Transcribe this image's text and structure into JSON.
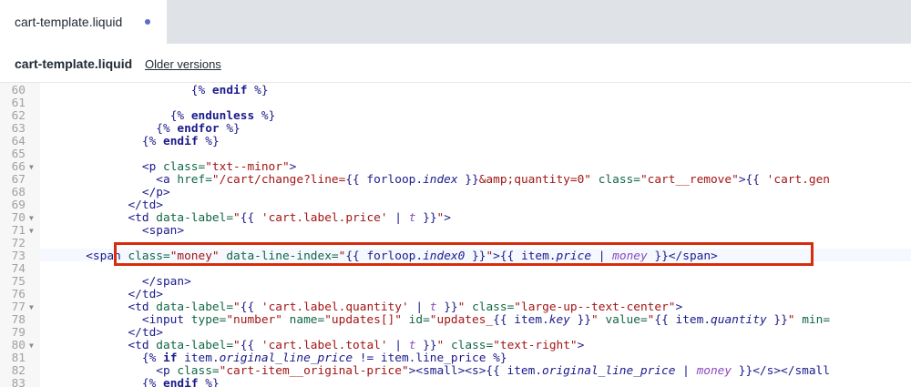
{
  "tab": {
    "label": "cart-template.liquid"
  },
  "header": {
    "title": "cart-template.liquid",
    "older_versions": "Older versions"
  },
  "editor": {
    "highlighted_line": 73,
    "lines": [
      {
        "n": "60",
        "fold": false,
        "indent": "",
        "code": [
          {
            "t": "                     "
          },
          {
            "t": "{% ",
            "c": "t-var"
          },
          {
            "t": "endif",
            "c": "t-kw"
          },
          {
            "t": " %}",
            "c": "t-var"
          }
        ]
      },
      {
        "n": "61",
        "fold": false,
        "code": []
      },
      {
        "n": "62",
        "fold": false,
        "code": [
          {
            "t": "                  "
          },
          {
            "t": "{% ",
            "c": "t-var"
          },
          {
            "t": "endunless",
            "c": "t-kw"
          },
          {
            "t": " %}",
            "c": "t-var"
          }
        ]
      },
      {
        "n": "63",
        "fold": false,
        "code": [
          {
            "t": "                "
          },
          {
            "t": "{% ",
            "c": "t-var"
          },
          {
            "t": "endfor",
            "c": "t-kw"
          },
          {
            "t": " %}",
            "c": "t-var"
          }
        ]
      },
      {
        "n": "64",
        "fold": false,
        "code": [
          {
            "t": "              "
          },
          {
            "t": "{% ",
            "c": "t-var"
          },
          {
            "t": "endif",
            "c": "t-kw"
          },
          {
            "t": " %}",
            "c": "t-var"
          }
        ]
      },
      {
        "n": "65",
        "fold": false,
        "code": []
      },
      {
        "n": "66",
        "fold": true,
        "code": [
          {
            "t": "              <p ",
            "c": "t-tag"
          },
          {
            "t": "class=",
            "c": "t-attr"
          },
          {
            "t": "\"txt--minor\"",
            "c": "t-str"
          },
          {
            "t": ">",
            "c": "t-tag"
          }
        ]
      },
      {
        "n": "67",
        "fold": false,
        "code": [
          {
            "t": "                <a ",
            "c": "t-tag"
          },
          {
            "t": "href=",
            "c": "t-attr"
          },
          {
            "t": "\"/cart/change?line=",
            "c": "t-str"
          },
          {
            "t": "{{ forloop.",
            "c": "t-var"
          },
          {
            "t": "index",
            "c": "t-prop"
          },
          {
            "t": " }}",
            "c": "t-var"
          },
          {
            "t": "&amp;quantity=0\"",
            "c": "t-str"
          },
          {
            "t": " class=",
            "c": "t-attr"
          },
          {
            "t": "\"cart__remove\"",
            "c": "t-str"
          },
          {
            "t": ">",
            "c": "t-tag"
          },
          {
            "t": "{{ ",
            "c": "t-var"
          },
          {
            "t": "'cart.gen",
            "c": "t-str"
          }
        ]
      },
      {
        "n": "68",
        "fold": false,
        "code": [
          {
            "t": "              </p>",
            "c": "t-tag"
          }
        ]
      },
      {
        "n": "69",
        "fold": false,
        "code": [
          {
            "t": "            </td>",
            "c": "t-tag"
          }
        ]
      },
      {
        "n": "70",
        "fold": true,
        "code": [
          {
            "t": "            <td ",
            "c": "t-tag"
          },
          {
            "t": "data-label=",
            "c": "t-attr"
          },
          {
            "t": "\"",
            "c": "t-str"
          },
          {
            "t": "{{ ",
            "c": "t-var"
          },
          {
            "t": "'cart.label.price'",
            "c": "t-str"
          },
          {
            "t": " | ",
            "c": "t-var"
          },
          {
            "t": "t",
            "c": "t-filter"
          },
          {
            "t": " }}",
            "c": "t-var"
          },
          {
            "t": "\"",
            "c": "t-str"
          },
          {
            "t": ">",
            "c": "t-tag"
          }
        ]
      },
      {
        "n": "71",
        "fold": true,
        "code": [
          {
            "t": "              <span>",
            "c": "t-tag"
          }
        ]
      },
      {
        "n": "72",
        "fold": false,
        "code": []
      },
      {
        "n": "73",
        "fold": false,
        "code": [
          {
            "t": "      <span ",
            "c": "t-tag"
          },
          {
            "t": "class=",
            "c": "t-attr"
          },
          {
            "t": "\"money\"",
            "c": "t-str"
          },
          {
            "t": " data-line-index=",
            "c": "t-attr"
          },
          {
            "t": "\"",
            "c": "t-str"
          },
          {
            "t": "{{ forloop.",
            "c": "t-var"
          },
          {
            "t": "index0",
            "c": "t-prop"
          },
          {
            "t": " }}",
            "c": "t-var"
          },
          {
            "t": "\"",
            "c": "t-str"
          },
          {
            "t": ">",
            "c": "t-tag"
          },
          {
            "t": "{{ item.",
            "c": "t-var"
          },
          {
            "t": "price",
            "c": "t-prop"
          },
          {
            "t": " | ",
            "c": "t-var"
          },
          {
            "t": "money",
            "c": "t-filter"
          },
          {
            "t": " }}",
            "c": "t-var"
          },
          {
            "t": "</span>",
            "c": "t-tag"
          }
        ]
      },
      {
        "n": "74",
        "fold": false,
        "code": []
      },
      {
        "n": "75",
        "fold": false,
        "code": [
          {
            "t": "              </span>",
            "c": "t-tag"
          }
        ]
      },
      {
        "n": "76",
        "fold": false,
        "code": [
          {
            "t": "            </td>",
            "c": "t-tag"
          }
        ]
      },
      {
        "n": "77",
        "fold": true,
        "code": [
          {
            "t": "            <td ",
            "c": "t-tag"
          },
          {
            "t": "data-label=",
            "c": "t-attr"
          },
          {
            "t": "\"",
            "c": "t-str"
          },
          {
            "t": "{{ ",
            "c": "t-var"
          },
          {
            "t": "'cart.label.quantity'",
            "c": "t-str"
          },
          {
            "t": " | ",
            "c": "t-var"
          },
          {
            "t": "t",
            "c": "t-filter"
          },
          {
            "t": " }}",
            "c": "t-var"
          },
          {
            "t": "\"",
            "c": "t-str"
          },
          {
            "t": " class=",
            "c": "t-attr"
          },
          {
            "t": "\"large-up--text-center\"",
            "c": "t-str"
          },
          {
            "t": ">",
            "c": "t-tag"
          }
        ]
      },
      {
        "n": "78",
        "fold": false,
        "code": [
          {
            "t": "              <input ",
            "c": "t-tag"
          },
          {
            "t": "type=",
            "c": "t-attr"
          },
          {
            "t": "\"number\"",
            "c": "t-str"
          },
          {
            "t": " name=",
            "c": "t-attr"
          },
          {
            "t": "\"updates[]\"",
            "c": "t-str"
          },
          {
            "t": " id=",
            "c": "t-attr"
          },
          {
            "t": "\"updates_",
            "c": "t-str"
          },
          {
            "t": "{{ item.",
            "c": "t-var"
          },
          {
            "t": "key",
            "c": "t-prop"
          },
          {
            "t": " }}",
            "c": "t-var"
          },
          {
            "t": "\"",
            "c": "t-str"
          },
          {
            "t": " value=",
            "c": "t-attr"
          },
          {
            "t": "\"",
            "c": "t-str"
          },
          {
            "t": "{{ item.",
            "c": "t-var"
          },
          {
            "t": "quantity",
            "c": "t-prop"
          },
          {
            "t": " }}",
            "c": "t-var"
          },
          {
            "t": "\"",
            "c": "t-str"
          },
          {
            "t": " min=",
            "c": "t-attr"
          }
        ]
      },
      {
        "n": "79",
        "fold": false,
        "code": [
          {
            "t": "            </td>",
            "c": "t-tag"
          }
        ]
      },
      {
        "n": "80",
        "fold": true,
        "code": [
          {
            "t": "            <td ",
            "c": "t-tag"
          },
          {
            "t": "data-label=",
            "c": "t-attr"
          },
          {
            "t": "\"",
            "c": "t-str"
          },
          {
            "t": "{{ ",
            "c": "t-var"
          },
          {
            "t": "'cart.label.total'",
            "c": "t-str"
          },
          {
            "t": " | ",
            "c": "t-var"
          },
          {
            "t": "t",
            "c": "t-filter"
          },
          {
            "t": " }}",
            "c": "t-var"
          },
          {
            "t": "\"",
            "c": "t-str"
          },
          {
            "t": " class=",
            "c": "t-attr"
          },
          {
            "t": "\"text-right\"",
            "c": "t-str"
          },
          {
            "t": ">",
            "c": "t-tag"
          }
        ]
      },
      {
        "n": "81",
        "fold": false,
        "code": [
          {
            "t": "              "
          },
          {
            "t": "{% ",
            "c": "t-var"
          },
          {
            "t": "if",
            "c": "t-kw"
          },
          {
            "t": " item.",
            "c": "t-var"
          },
          {
            "t": "original_line_price",
            "c": "t-prop"
          },
          {
            "t": " != item.line_price %}",
            "c": "t-var"
          }
        ]
      },
      {
        "n": "82",
        "fold": false,
        "code": [
          {
            "t": "                <p ",
            "c": "t-tag"
          },
          {
            "t": "class=",
            "c": "t-attr"
          },
          {
            "t": "\"cart-item__original-price\"",
            "c": "t-str"
          },
          {
            "t": "><small><s>",
            "c": "t-tag"
          },
          {
            "t": "{{ item.",
            "c": "t-var"
          },
          {
            "t": "original_line_price",
            "c": "t-prop"
          },
          {
            "t": " | ",
            "c": "t-var"
          },
          {
            "t": "money",
            "c": "t-filter"
          },
          {
            "t": " }}",
            "c": "t-var"
          },
          {
            "t": "</s></small",
            "c": "t-tag"
          }
        ]
      },
      {
        "n": "83",
        "fold": false,
        "code": [
          {
            "t": "              "
          },
          {
            "t": "{% ",
            "c": "t-var"
          },
          {
            "t": "endif",
            "c": "t-kw"
          },
          {
            "t": " %}",
            "c": "t-var"
          }
        ]
      }
    ]
  }
}
